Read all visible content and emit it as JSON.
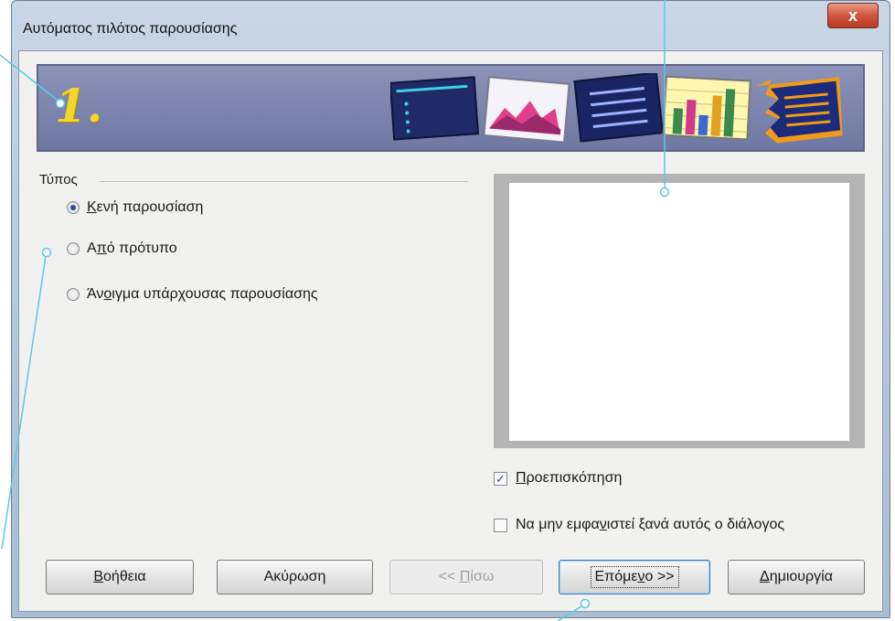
{
  "window": {
    "title": "Αυτόματος πιλότος παρουσίασης",
    "close_label": "x"
  },
  "banner": {
    "step_number": "1."
  },
  "type_group": {
    "label": "Τύπος",
    "options": [
      {
        "pre": "",
        "ul": "Κ",
        "post": "ενή παρουσίαση",
        "selected": true
      },
      {
        "pre": "Α",
        "ul": "π",
        "post": "ό πρότυπο",
        "selected": false
      },
      {
        "pre": "Άν",
        "ul": "ο",
        "post": "ιγμα υπάρχουσας παρουσίασης",
        "selected": false
      }
    ]
  },
  "preview": {
    "preview_check": {
      "ul": "Π",
      "post": "ροεπισκόπηση",
      "checked": true
    },
    "dont_show_check": {
      "pre": "Να μην εμφα",
      "ul": "ν",
      "post": "ιστεί ξανά αυτός ο διάλογος",
      "checked": false
    }
  },
  "buttons": {
    "help": {
      "ul": "Β",
      "post": "οήθεια"
    },
    "cancel": "Ακύρωση",
    "back": {
      "pre": "<< ",
      "ul": "Π",
      "post": "ίσω"
    },
    "next": {
      "pre": "Επόμε",
      "ul": "ν",
      "post": "ο >>"
    },
    "create": {
      "ul": "Δ",
      "post": "ημιουργία"
    }
  },
  "colors": {
    "callout": "#5bc8ea",
    "banner": "#7b84ad",
    "step_number": "#f4d629"
  }
}
